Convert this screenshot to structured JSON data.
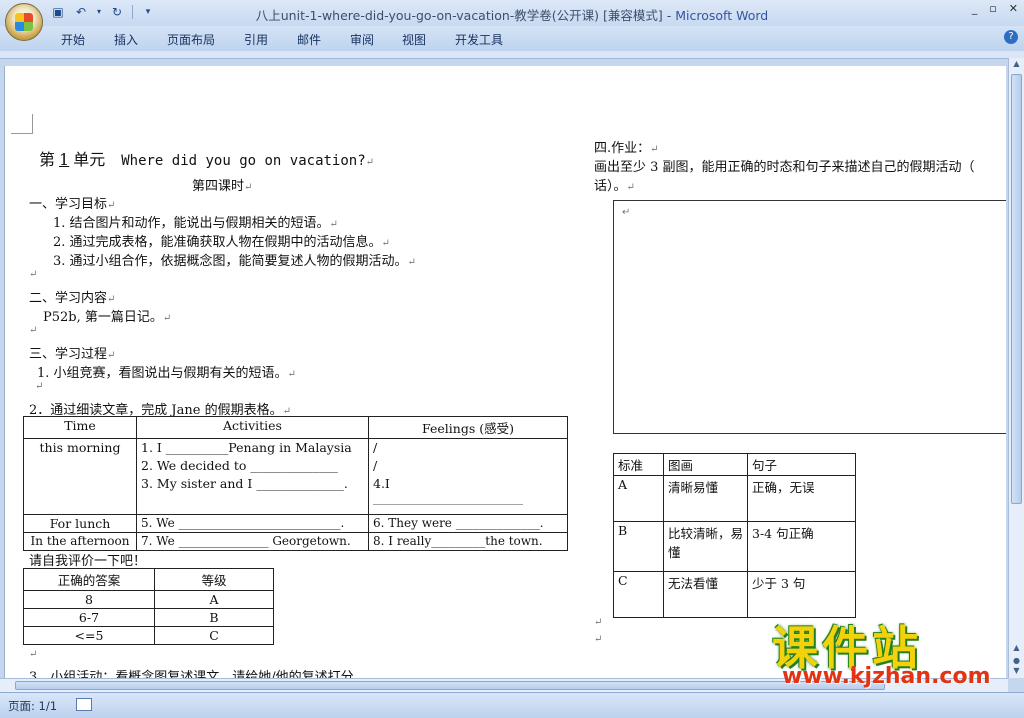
{
  "window": {
    "title_doc": "八上unit-1-where-did-you-go-on-vacation-教学卷(公开课) [兼容模式] - ",
    "title_app": "Microsoft Word"
  },
  "ribbon_tabs": [
    "开始",
    "插入",
    "页面布局",
    "引用",
    "邮件",
    "审阅",
    "视图",
    "开发工具"
  ],
  "doc": {
    "heading_prefix": "第",
    "heading_num": "1",
    "heading_suffix": "单元",
    "heading_en": "Where did you go on vacation?",
    "lesson": "第四课时",
    "s1_title": "一、学习目标",
    "s1_items": [
      "1.  结合图片和动作，能说出与假期相关的短语。",
      "2.  通过完成表格，能准确获取人物在假期中的活动信息。",
      "3.  通过小组合作，依据概念图，能简要复述人物的假期活动。"
    ],
    "s2_title": "二、学习内容",
    "s2_body": "P52b, 第一篇日记。",
    "s3_title": "三、学习过程",
    "s3_1": "1. 小组竞赛，看图说出与假期有关的短语。",
    "s3_2": "2．通过细读文章，完成 Jane 的假期表格。",
    "self_eval": "请自我评价一下吧！",
    "s3_3": "3．小组活动：看概念图复述课文，请给她/他的复述打分",
    "hw_title": "四.作业：",
    "hw_body1": "画出至少 3 副图，能用正确的时态和句子来描述自己的假期活动（",
    "hw_body2": "话）。"
  },
  "jane_table": {
    "headers": [
      "Time",
      "Activities",
      "Feelings (感受)"
    ],
    "row1_time": "this morning",
    "row1_acts": [
      "1.   I __________Penang in Malaysia",
      "2.   We decided  to ______________",
      "3.   My sister and I ______________."
    ],
    "row1_feel": [
      "/",
      "/",
      "4.I"
    ],
    "row1_feel_blank": "______________________________",
    "row2_time": "For lunch",
    "row2_act": "5. We ___________________________.",
    "row2_feel": "6. They were ______________.",
    "row3_time": "In the afternoon",
    "row3_act": "7. We _______________  Georgetown.",
    "row3_feel": "8. I really_________the  town."
  },
  "grade_table": {
    "headers": [
      "正确的答案",
      "等级"
    ],
    "rows": [
      [
        "8",
        "A"
      ],
      [
        "6-7",
        "B"
      ],
      [
        "<=5",
        "C"
      ]
    ]
  },
  "criteria_table": {
    "headers": [
      "标准",
      "图画",
      "句子"
    ],
    "rows": [
      [
        "A",
        "清晰易懂",
        "正确，无误"
      ],
      [
        "B",
        "比较清晰，易懂",
        "3-4 句正确"
      ],
      [
        "C",
        "无法看懂",
        "少于 3 句"
      ]
    ]
  },
  "status": {
    "page": "页面: 1/1"
  },
  "watermark": {
    "big": "课件站",
    "url": "www.kjzhan.com"
  }
}
